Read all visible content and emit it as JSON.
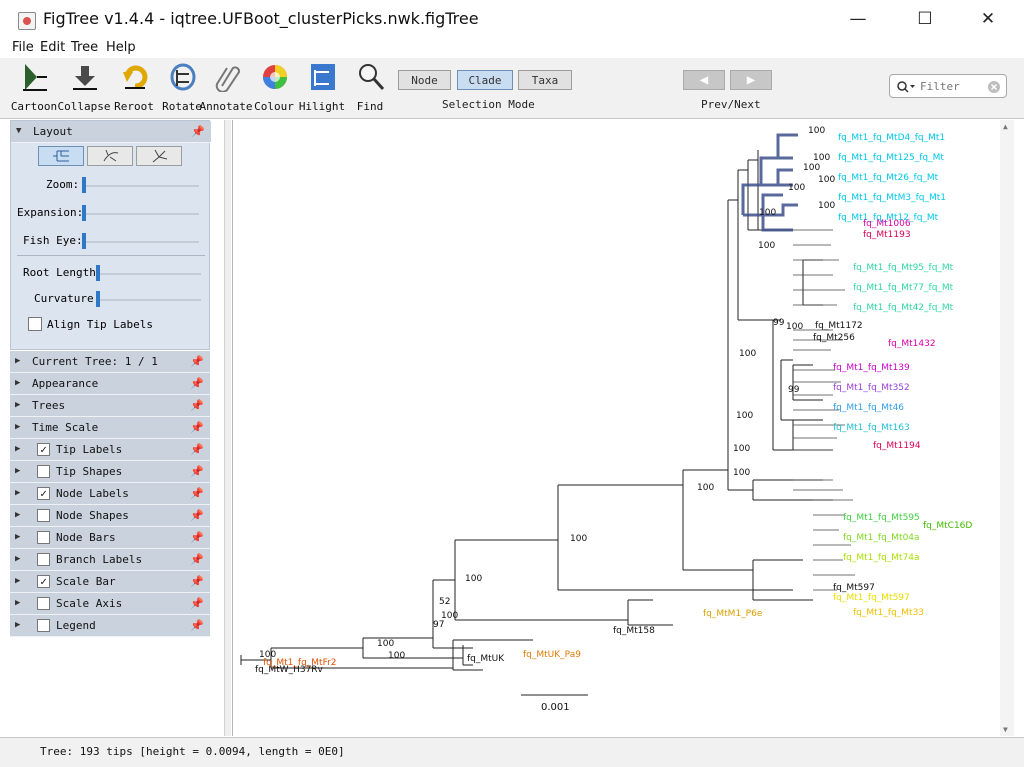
{
  "window": {
    "title": "FigTree v1.4.4 - iqtree.UFBoot_clusterPicks.nwk.figTree",
    "minimize": "—",
    "maximize": "☐",
    "close": "✕"
  },
  "menu": [
    "File",
    "Edit",
    "Tree",
    "Help"
  ],
  "toolbar": {
    "tools": [
      {
        "label": "Cartoon",
        "icon": "cartoon-icon"
      },
      {
        "label": "Collapse",
        "icon": "collapse-icon"
      },
      {
        "label": "Reroot",
        "icon": "reroot-icon"
      },
      {
        "label": "Rotate",
        "icon": "rotate-icon"
      },
      {
        "label": "Annotate",
        "icon": "paperclip-icon"
      },
      {
        "label": "Colour",
        "icon": "colour-wheel-icon"
      },
      {
        "label": "Hilight",
        "icon": "hilight-icon"
      },
      {
        "label": "Find",
        "icon": "magnifier-icon"
      }
    ],
    "selection_mode": {
      "caption": "Selection Mode",
      "options": [
        "Node",
        "Clade",
        "Taxa"
      ],
      "selected": "Clade"
    },
    "prev_next": {
      "caption": "Prev/Next",
      "prev": "◀",
      "next": "▶"
    },
    "filter": {
      "placeholder": "Filter"
    }
  },
  "layout_panel": {
    "title": "Layout",
    "sliders": [
      {
        "label": "Zoom:",
        "value": 0
      },
      {
        "label": "Expansion:",
        "value": 0
      },
      {
        "label": "Fish Eye:",
        "value": 0
      },
      {
        "label": "Root Length:",
        "value": 0
      },
      {
        "label": "Curvature:",
        "value": 0
      }
    ],
    "align_tip_labels": "Align Tip Labels"
  },
  "panels": [
    {
      "label": "Current Tree: 1 / 1",
      "checkbox": null
    },
    {
      "label": "Appearance",
      "checkbox": null
    },
    {
      "label": "Trees",
      "checkbox": null
    },
    {
      "label": "Time Scale",
      "checkbox": null
    },
    {
      "label": "Tip Labels",
      "checkbox": true
    },
    {
      "label": "Tip Shapes",
      "checkbox": false
    },
    {
      "label": "Node Labels",
      "checkbox": true
    },
    {
      "label": "Node Shapes",
      "checkbox": false
    },
    {
      "label": "Node Bars",
      "checkbox": false
    },
    {
      "label": "Branch Labels",
      "checkbox": false
    },
    {
      "label": "Scale Bar",
      "checkbox": true
    },
    {
      "label": "Scale Axis",
      "checkbox": false
    },
    {
      "label": "Legend",
      "checkbox": false
    }
  ],
  "tree": {
    "scale_bar_label": "0.001",
    "node_labels": [
      "100",
      "100",
      "100",
      "100",
      "100",
      "100",
      "100",
      "100",
      "99",
      "100",
      "100",
      "100",
      "100",
      "100",
      "100",
      "52",
      "100",
      "97",
      "100",
      "100",
      "100",
      "99",
      "100",
      "100"
    ],
    "tip_labels": [
      {
        "text": "fq_MtUK",
        "color": "#111111"
      },
      {
        "text": "fq_MtW_H37Rv",
        "color": "#111111"
      },
      {
        "text": "fq_MtUK_Pa9",
        "color": "#e07b00"
      },
      {
        "text": "fq_Mt1_fq_MtFr2",
        "color": "#e05000"
      },
      {
        "text": "fq_Mt158",
        "color": "#111111"
      },
      {
        "text": "fq_MtM1_P6e",
        "color": "#d9a000"
      },
      {
        "text": "fq_Mt597",
        "color": "#111111"
      },
      {
        "text": "fq_MtC16D",
        "color": "#44bb00"
      },
      {
        "text": "fq_Mt1194",
        "color": "#e00050"
      },
      {
        "text": "fq_Mt1432",
        "color": "#dd00aa"
      },
      {
        "text": "fq_Mt1172",
        "color": "#111111"
      },
      {
        "text": "fq_Mt1006",
        "color": "#dd00aa"
      },
      {
        "text": "fq_Mt1193",
        "color": "#e00050"
      },
      {
        "text": "fq_Mt256",
        "color": "#111111"
      }
    ]
  },
  "status": "Tree: 193 tips [height = 0.0094, length = 0E0]"
}
